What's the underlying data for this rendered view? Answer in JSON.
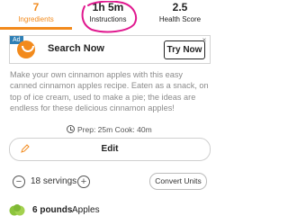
{
  "tabs": [
    {
      "value": "7",
      "label": "Ingredients",
      "active": true
    },
    {
      "value": "1h 5m",
      "label": "Instructions",
      "active": false
    },
    {
      "value": "2.5",
      "label": "Health Score",
      "active": false
    }
  ],
  "colors": {
    "accent": "#f28a1c",
    "annotation": "#e0198f",
    "ad_tag": "#2f80b6"
  },
  "ad": {
    "tag": "Ad",
    "title": "Search Now",
    "button": "Try Now",
    "close": "×",
    "logo_icon": "smile-logo-icon"
  },
  "description": "Make your own cinnamon apples with this easy canned cinnamon apples recipe. Eaten as a snack, on top of ice cream, used to make a pie; the ideas are endless for these delicious cinnamon apples!",
  "times": {
    "text": "Prep: 25m  Cook: 40m",
    "icon": "clock-icon"
  },
  "edit": {
    "label": "Edit",
    "icon": "pencil-icon"
  },
  "servings": {
    "minus": "−",
    "label": "18 servings",
    "plus": "+",
    "convert": "Convert Units"
  },
  "ingredient": {
    "quantity": "6 pounds",
    "name": "Apples",
    "icon": "apple-image"
  }
}
